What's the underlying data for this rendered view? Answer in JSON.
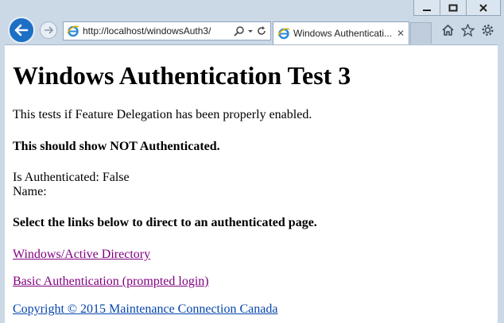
{
  "browser": {
    "address_url": "http://localhost/windowsAuth3/",
    "tab_title": "Windows Authenticati...",
    "icons": [
      "back-arrow-icon",
      "forward-arrow-icon",
      "ie-logo-icon",
      "search-icon",
      "dropdown-icon",
      "refresh-icon",
      "tab-close-icon",
      "home-icon",
      "favorites-star-icon",
      "settings-gear-icon",
      "minimize-icon",
      "maximize-icon",
      "close-icon"
    ],
    "colors": {
      "chrome": "#cbd8e6",
      "back_button": "#1c6fc4",
      "visited_link": "#800080",
      "link": "#0645ad"
    }
  },
  "page": {
    "heading": "Windows Authentication Test 3",
    "intro": "This tests if Feature Delegation has been properly enabled.",
    "expectation": "This should show NOT Authenticated.",
    "is_authenticated_label": "Is Authenticated: False",
    "name_label": "Name:",
    "links_instruction": "Select the links below to direct to an authenticated page.",
    "links": [
      "Windows/Active Directory",
      "Basic Authentication (prompted login)",
      "Copyright © 2015 Maintenance Connection Canada"
    ]
  }
}
